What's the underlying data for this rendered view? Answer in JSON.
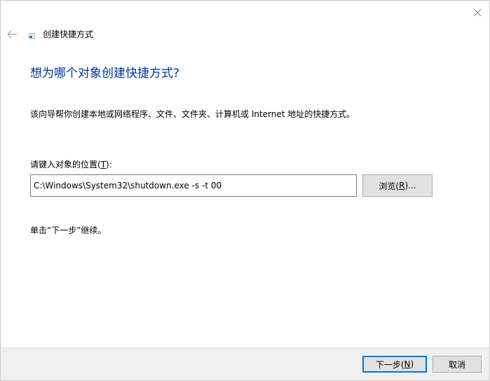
{
  "window": {
    "title": "创建快捷方式"
  },
  "icons": {
    "close": "close-icon",
    "back": "back-arrow-icon",
    "app": "shortcut-wizard-icon"
  },
  "main": {
    "heading": "想为哪个对象创建快捷方式?",
    "description": "该向导帮你创建本地或网络程序、文件、文件夹、计算机或 Internet 地址的快捷方式。",
    "location_label_prefix": "请键入对象的位置(",
    "location_label_key": "T",
    "location_label_suffix": "):",
    "location_value": "C:\\Windows\\System32\\shutdown.exe -s -t 00",
    "browse_prefix": "浏览(",
    "browse_key": "R",
    "browse_suffix": ")...",
    "hint": "单击“下一步”继续。"
  },
  "footer": {
    "next_prefix": "下一步(",
    "next_key": "N",
    "next_suffix": ")",
    "cancel_label": "取消"
  },
  "colors": {
    "heading": "#003399",
    "accent_border": "#0078d7",
    "footer_bg": "#f0f0f0",
    "button_bg": "#e1e1e1"
  }
}
